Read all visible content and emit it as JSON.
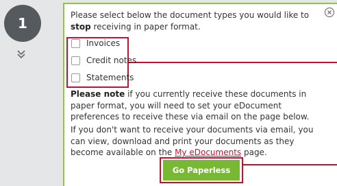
{
  "step": {
    "number": "1"
  },
  "intro": {
    "text_before": "Please select below the document types you would like to ",
    "emphasis": "stop",
    "text_after": " receiving in paper format."
  },
  "options": [
    {
      "label": "Invoices",
      "checked": false
    },
    {
      "label": "Credit notes",
      "checked": false
    },
    {
      "label": "Statements",
      "checked": false
    }
  ],
  "note": {
    "label": "Please note",
    "text": " if you currently receive these documents in paper format, you will need to set your eDocument preferences to receive these via email on the page below."
  },
  "info": {
    "text_before": "If you don't want to receive your documents via email, you can view, download and print your documents as they become available on the ",
    "link": "My eDocuments",
    "text_after": " page."
  },
  "cta": {
    "label": "Go Paperless"
  },
  "colors": {
    "accent_green": "#8cc63f",
    "button_green": "#78b833",
    "highlight_red": "#c8102e",
    "step_circle": "#555a5f"
  },
  "icons": {
    "step_expand": "double-chevron-down-icon",
    "close": "close-circle-icon"
  }
}
